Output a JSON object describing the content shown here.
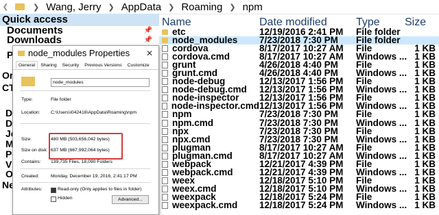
{
  "address": {
    "segments": [
      "Wang, Jerry",
      "AppData",
      "Roaming",
      "npm"
    ]
  },
  "nav": {
    "quick_access": "Quick access",
    "items": [
      {
        "label": "Documents"
      },
      {
        "label": "Downloads"
      }
    ],
    "clipped": [
      "Pi",
      "Or",
      "CTU",
      "De",
      "Do",
      "Je",
      "Mu",
      "Pic",
      "Vi",
      "OS",
      "Net"
    ]
  },
  "columns": {
    "name": "Name",
    "date": "Date modified",
    "type": "Type",
    "size": "Size"
  },
  "files": [
    {
      "name": "etc",
      "date": "12/19/2016 2:41 PM",
      "type": "File folder",
      "size": "",
      "kind": "folder"
    },
    {
      "name": "node_modules",
      "date": "7/23/2018 7:30 PM",
      "type": "File folder",
      "size": "",
      "kind": "folder"
    },
    {
      "name": "cordova",
      "date": "8/17/2017 10:27 AM",
      "type": "File",
      "size": "1 KB",
      "kind": "file"
    },
    {
      "name": "cordova.cmd",
      "date": "8/17/2017 10:27 AM",
      "type": "Windows ...",
      "size": "1 KB",
      "kind": "file"
    },
    {
      "name": "grunt",
      "date": "4/26/2018 4:40 PM",
      "type": "File",
      "size": "1 KB",
      "kind": "file"
    },
    {
      "name": "grunt.cmd",
      "date": "4/26/2018 4:40 PM",
      "type": "Windows ...",
      "size": "1 KB",
      "kind": "file"
    },
    {
      "name": "node-debug",
      "date": "12/13/2017 1:56 PM",
      "type": "File",
      "size": "1 KB",
      "kind": "file"
    },
    {
      "name": "node-debug.cmd",
      "date": "12/13/2017 1:56 PM",
      "type": "Windows ...",
      "size": "1 KB",
      "kind": "file"
    },
    {
      "name": "node-inspector",
      "date": "12/13/2017 1:56 PM",
      "type": "File",
      "size": "1 KB",
      "kind": "file"
    },
    {
      "name": "node-inspector.cmd",
      "date": "12/13/2017 1:56 PM",
      "type": "Windows ...",
      "size": "1 KB",
      "kind": "file"
    },
    {
      "name": "npm",
      "date": "7/23/2018 7:30 PM",
      "type": "File",
      "size": "1 KB",
      "kind": "file"
    },
    {
      "name": "npm.cmd",
      "date": "7/23/2018 7:30 PM",
      "type": "Windows ...",
      "size": "1 KB",
      "kind": "file"
    },
    {
      "name": "npx",
      "date": "7/23/2018 7:30 PM",
      "type": "File",
      "size": "1 KB",
      "kind": "file"
    },
    {
      "name": "npx.cmd",
      "date": "7/23/2018 7:30 PM",
      "type": "Windows ...",
      "size": "1 KB",
      "kind": "file"
    },
    {
      "name": "plugman",
      "date": "8/17/2017 10:27 AM",
      "type": "File",
      "size": "1 KB",
      "kind": "file"
    },
    {
      "name": "plugman.cmd",
      "date": "8/17/2017 10:27 AM",
      "type": "Windows ...",
      "size": "1 KB",
      "kind": "file"
    },
    {
      "name": "webpack",
      "date": "12/21/2017 4:39 PM",
      "type": "File",
      "size": "1 KB",
      "kind": "file"
    },
    {
      "name": "webpack.cmd",
      "date": "12/21/2017 4:39 PM",
      "type": "Windows ...",
      "size": "1 KB",
      "kind": "file"
    },
    {
      "name": "weex",
      "date": "12/18/2017 5:10 PM",
      "type": "File",
      "size": "1 KB",
      "kind": "file"
    },
    {
      "name": "weex.cmd",
      "date": "12/18/2017 5:10 PM",
      "type": "Windows ...",
      "size": "1 KB",
      "kind": "file"
    },
    {
      "name": "weexpack",
      "date": "12/18/2017 5:24 PM",
      "type": "File",
      "size": "1 KB",
      "kind": "file"
    },
    {
      "name": "weexpack.cmd",
      "date": "12/18/2017 5:24 PM",
      "type": "Windows ...",
      "size": "1 KB",
      "kind": "file"
    }
  ],
  "dialog": {
    "title": "node_modules Properties",
    "tabs": [
      "General",
      "Sharing",
      "Security",
      "Previous Versions",
      "Customize"
    ],
    "name_value": "node_modules",
    "type_label": "Type:",
    "type_value": "File folder",
    "location_label": "Location:",
    "location_value": "C:\\Users\\i042416\\AppData\\Roaming\\npm",
    "size_label": "Size:",
    "size_value": "480 MB (503,656,042 bytes)",
    "sod_label": "Size on disk:",
    "sod_value": "637 MB (667,992,064 bytes)",
    "contains_label": "Contains:",
    "contains_value": "139,735 Files, 18,090 Folders",
    "created_label": "Created:",
    "created_value": "Monday, December 19, 2016, 2:41:17 PM",
    "attributes_label": "Attributes:",
    "readonly_label": "Read-only (Only applies to files in folder)",
    "hidden_label": "Hidden",
    "advanced_label": "Advanced..."
  }
}
